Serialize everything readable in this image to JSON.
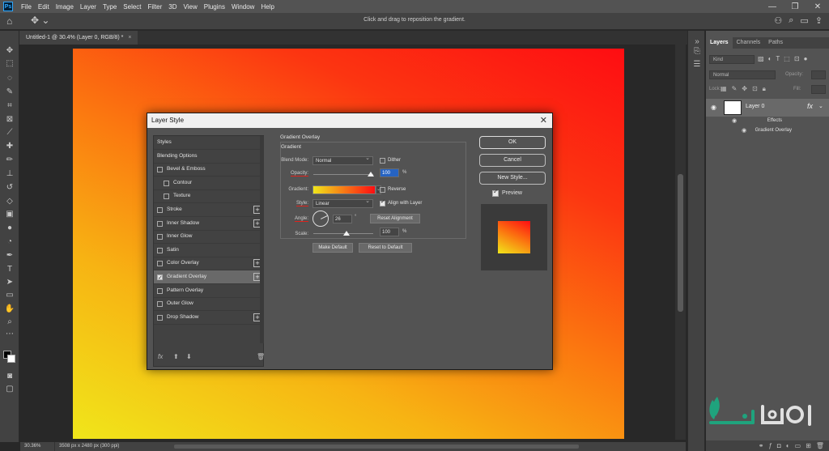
{
  "app": {
    "logo_label": "Ps",
    "menu": [
      "File",
      "Edit",
      "Image",
      "Layer",
      "Type",
      "Select",
      "Filter",
      "3D",
      "View",
      "Plugins",
      "Window",
      "Help"
    ],
    "window_controls": [
      "—",
      "❐",
      "✕"
    ]
  },
  "optionsbar": {
    "hint": "Click and drag to reposition the gradient."
  },
  "document": {
    "tab_title": "Untitled-1 @ 30.4% (Layer 0, RGB/8) *",
    "tab_close": "×",
    "zoom": "30.36%",
    "doc_info": "3508 px x 2480 px (300 ppi)"
  },
  "colors": {
    "gradient_start": "#f0e61a",
    "gradient_end": "#fe0d12",
    "accent_underline": "#e0221c",
    "highlight": "#2663c2"
  },
  "layers_panel": {
    "tabs": [
      "Layers",
      "Channels",
      "Paths"
    ],
    "kind_placeholder": "Kind",
    "blend_mode": "Normal",
    "opacity_label": "Opacity:",
    "lock_label": "Lock:",
    "fill_label": "Fill:",
    "layer_name": "Layer 0",
    "fx_label": "fx",
    "effects_label": "Effects",
    "effect_item": "Gradient Overlay"
  },
  "dialog": {
    "title": "Layer Style",
    "close": "✕",
    "style_items": [
      {
        "label": "Styles",
        "type": "header"
      },
      {
        "label": "Blending Options",
        "type": "header"
      },
      {
        "label": "Bevel & Emboss",
        "type": "check",
        "checked": false,
        "plus": false,
        "indent": 0
      },
      {
        "label": "Contour",
        "type": "check",
        "checked": false,
        "plus": false,
        "indent": 1
      },
      {
        "label": "Texture",
        "type": "check",
        "checked": false,
        "plus": false,
        "indent": 1
      },
      {
        "label": "Stroke",
        "type": "check",
        "checked": false,
        "plus": true,
        "indent": 0
      },
      {
        "label": "Inner Shadow",
        "type": "check",
        "checked": false,
        "plus": true,
        "indent": 0
      },
      {
        "label": "Inner Glow",
        "type": "check",
        "checked": false,
        "plus": false,
        "indent": 0
      },
      {
        "label": "Satin",
        "type": "check",
        "checked": false,
        "plus": false,
        "indent": 0
      },
      {
        "label": "Color Overlay",
        "type": "check",
        "checked": false,
        "plus": true,
        "indent": 0
      },
      {
        "label": "Gradient Overlay",
        "type": "check",
        "checked": true,
        "plus": true,
        "indent": 0,
        "selected": true
      },
      {
        "label": "Pattern Overlay",
        "type": "check",
        "checked": false,
        "plus": false,
        "indent": 0
      },
      {
        "label": "Outer Glow",
        "type": "check",
        "checked": false,
        "plus": false,
        "indent": 0
      },
      {
        "label": "Drop Shadow",
        "type": "check",
        "checked": false,
        "plus": true,
        "indent": 0
      }
    ],
    "footer_fx": "fx",
    "section_title": "Gradient Overlay",
    "group_title": "Gradient",
    "blend_mode_label": "Blend Mode:",
    "blend_mode_value": "Normal",
    "dither_label": "Dither",
    "opacity_label": "Opacity:",
    "opacity_value": "100",
    "percent": "%",
    "gradient_label": "Gradient:",
    "reverse_label": "Reverse",
    "style_label": "Style:",
    "style_value": "Linear",
    "align_label": "Align with Layer",
    "angle_label": "Angle:",
    "angle_value": "26",
    "degree": "°",
    "reset_alignment": "Reset Alignment",
    "scale_label": "Scale:",
    "scale_value": "100",
    "make_default": "Make Default",
    "reset_default": "Reset to Default",
    "ok": "OK",
    "cancel": "Cancel",
    "new_style": "New Style...",
    "preview_label": "Preview"
  }
}
